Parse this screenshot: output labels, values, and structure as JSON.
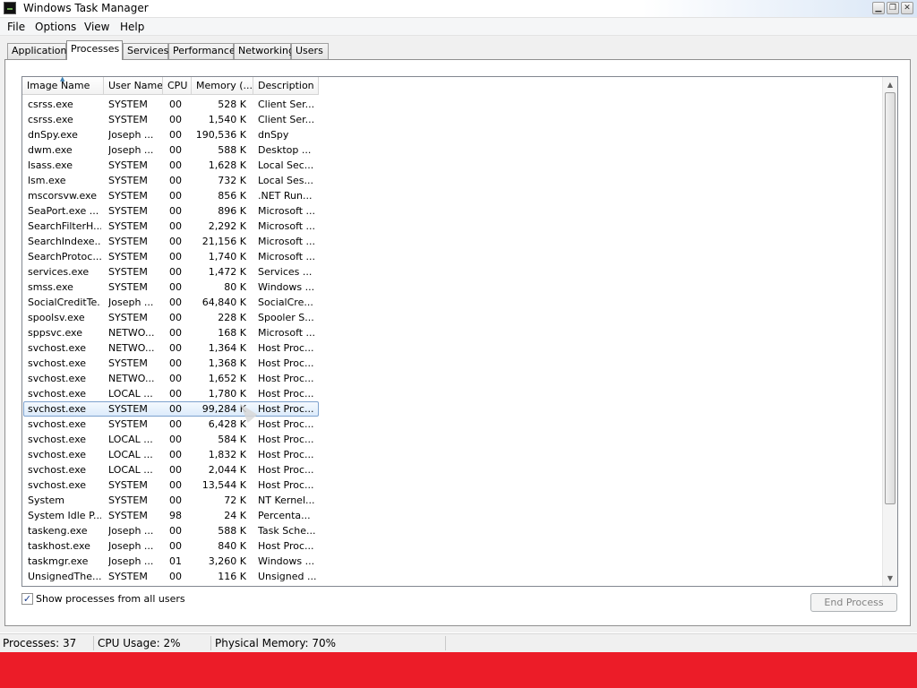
{
  "window": {
    "title": "Windows Task Manager",
    "buttons": [
      "▁",
      "❐",
      "✕"
    ]
  },
  "menu": [
    "File",
    "Options",
    "View",
    "Help"
  ],
  "tabs": [
    "Applications",
    "Processes",
    "Services",
    "Performance",
    "Networking",
    "Users"
  ],
  "active_tab": "Processes",
  "columns": [
    "Image Name",
    "User Name",
    "CPU",
    "Memory (...",
    "Description"
  ],
  "processes": [
    {
      "name": "csrss.exe",
      "user": "SYSTEM",
      "cpu": "00",
      "mem": "528 K",
      "desc": "Client Ser..."
    },
    {
      "name": "csrss.exe",
      "user": "SYSTEM",
      "cpu": "00",
      "mem": "1,540 K",
      "desc": "Client Ser..."
    },
    {
      "name": "dnSpy.exe",
      "user": "Joseph ...",
      "cpu": "00",
      "mem": "190,536 K",
      "desc": "dnSpy"
    },
    {
      "name": "dwm.exe",
      "user": "Joseph ...",
      "cpu": "00",
      "mem": "588 K",
      "desc": "Desktop ..."
    },
    {
      "name": "lsass.exe",
      "user": "SYSTEM",
      "cpu": "00",
      "mem": "1,628 K",
      "desc": "Local Sec..."
    },
    {
      "name": "lsm.exe",
      "user": "SYSTEM",
      "cpu": "00",
      "mem": "732 K",
      "desc": "Local Ses..."
    },
    {
      "name": "mscorsvw.exe",
      "user": "SYSTEM",
      "cpu": "00",
      "mem": "856 K",
      "desc": ".NET Run..."
    },
    {
      "name": "SeaPort.exe ...",
      "user": "SYSTEM",
      "cpu": "00",
      "mem": "896 K",
      "desc": "Microsoft ..."
    },
    {
      "name": "SearchFilterH...",
      "user": "SYSTEM",
      "cpu": "00",
      "mem": "2,292 K",
      "desc": "Microsoft ..."
    },
    {
      "name": "SearchIndexe...",
      "user": "SYSTEM",
      "cpu": "00",
      "mem": "21,156 K",
      "desc": "Microsoft ..."
    },
    {
      "name": "SearchProtoc...",
      "user": "SYSTEM",
      "cpu": "00",
      "mem": "1,740 K",
      "desc": "Microsoft ..."
    },
    {
      "name": "services.exe",
      "user": "SYSTEM",
      "cpu": "00",
      "mem": "1,472 K",
      "desc": "Services ..."
    },
    {
      "name": "smss.exe",
      "user": "SYSTEM",
      "cpu": "00",
      "mem": "80 K",
      "desc": "Windows ..."
    },
    {
      "name": "SocialCreditTe...",
      "user": "Joseph ...",
      "cpu": "00",
      "mem": "64,840 K",
      "desc": "SocialCre..."
    },
    {
      "name": "spoolsv.exe",
      "user": "SYSTEM",
      "cpu": "00",
      "mem": "228 K",
      "desc": "Spooler S..."
    },
    {
      "name": "sppsvc.exe",
      "user": "NETWO...",
      "cpu": "00",
      "mem": "168 K",
      "desc": "Microsoft ..."
    },
    {
      "name": "svchost.exe",
      "user": "NETWO...",
      "cpu": "00",
      "mem": "1,364 K",
      "desc": "Host Proc..."
    },
    {
      "name": "svchost.exe",
      "user": "SYSTEM",
      "cpu": "00",
      "mem": "1,368 K",
      "desc": "Host Proc..."
    },
    {
      "name": "svchost.exe",
      "user": "NETWO...",
      "cpu": "00",
      "mem": "1,652 K",
      "desc": "Host Proc..."
    },
    {
      "name": "svchost.exe",
      "user": "LOCAL ...",
      "cpu": "00",
      "mem": "1,780 K",
      "desc": "Host Proc..."
    },
    {
      "name": "svchost.exe",
      "user": "SYSTEM",
      "cpu": "00",
      "mem": "99,284 K",
      "desc": "Host Proc...",
      "selected": true
    },
    {
      "name": "svchost.exe",
      "user": "SYSTEM",
      "cpu": "00",
      "mem": "6,428 K",
      "desc": "Host Proc..."
    },
    {
      "name": "svchost.exe",
      "user": "LOCAL ...",
      "cpu": "00",
      "mem": "584 K",
      "desc": "Host Proc..."
    },
    {
      "name": "svchost.exe",
      "user": "LOCAL ...",
      "cpu": "00",
      "mem": "1,832 K",
      "desc": "Host Proc..."
    },
    {
      "name": "svchost.exe",
      "user": "LOCAL ...",
      "cpu": "00",
      "mem": "2,044 K",
      "desc": "Host Proc..."
    },
    {
      "name": "svchost.exe",
      "user": "SYSTEM",
      "cpu": "00",
      "mem": "13,544 K",
      "desc": "Host Proc..."
    },
    {
      "name": "System",
      "user": "SYSTEM",
      "cpu": "00",
      "mem": "72 K",
      "desc": "NT Kernel..."
    },
    {
      "name": "System Idle P...",
      "user": "SYSTEM",
      "cpu": "98",
      "mem": "24 K",
      "desc": "Percenta..."
    },
    {
      "name": "taskeng.exe",
      "user": "Joseph ...",
      "cpu": "00",
      "mem": "588 K",
      "desc": "Task Sche..."
    },
    {
      "name": "taskhost.exe",
      "user": "Joseph ...",
      "cpu": "00",
      "mem": "840 K",
      "desc": "Host Proc..."
    },
    {
      "name": "taskmgr.exe",
      "user": "Joseph ...",
      "cpu": "01",
      "mem": "3,260 K",
      "desc": "Windows ..."
    },
    {
      "name": "UnsignedThe...",
      "user": "SYSTEM",
      "cpu": "00",
      "mem": "116 K",
      "desc": "Unsigned ..."
    }
  ],
  "show_all_users": {
    "label": "Show processes from all users",
    "checked": true,
    "mark": "✓"
  },
  "end_process_label": "End Process",
  "status": {
    "processes": "Processes: 37",
    "cpu": "CPU Usage: 2%",
    "memory": "Physical Memory: 70%"
  },
  "colors": {
    "accent_red": "#ec1c28",
    "selection_border": "#7da2ce"
  }
}
